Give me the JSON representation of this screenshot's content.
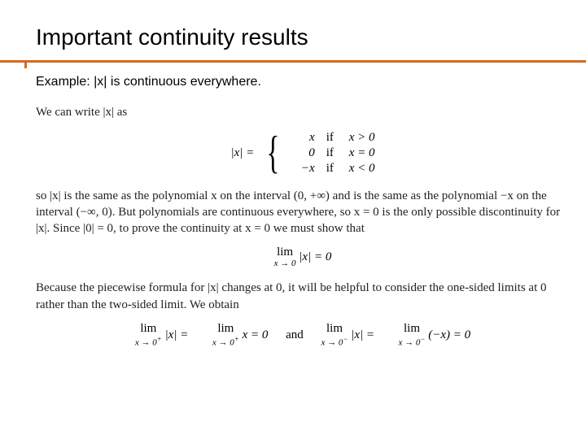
{
  "title": "Important continuity results",
  "example_label": "Example: |x| is continuous everywhere.",
  "intro": "We can write |x| as",
  "piecewise": {
    "lhs": "|x| =",
    "cases": [
      {
        "val": "x",
        "if": "if",
        "cond": "x > 0"
      },
      {
        "val": "0",
        "if": "if",
        "cond": "x = 0"
      },
      {
        "val": "−x",
        "if": "if",
        "cond": "x < 0"
      }
    ]
  },
  "para1": "so |x| is the same as the polynomial x on the interval (0, +∞) and is the same as the polynomial −x on the interval (−∞, 0). But polynomials are continuous everywhere, so x = 0 is the only possible discontinuity for |x|. Since |0| = 0, to prove the continuity at x = 0 we must show that",
  "limit_center": {
    "lim": "lim",
    "sub": "x → 0",
    "expr": "|x| = 0"
  },
  "para2": "Because the piecewise formula for |x| changes at 0, it will be helpful to consider the one-sided limits at 0 rather than the two-sided limit. We obtain",
  "limits_row": {
    "left": {
      "lim": "lim",
      "sub1": "x → 0",
      "sup1": "+",
      "expr1": "|x| =",
      "sub2": "x → 0",
      "sup2": "+",
      "expr2": "x = 0"
    },
    "and": "and",
    "right": {
      "lim": "lim",
      "sub1": "x → 0",
      "sup1": "−",
      "expr1": "|x| =",
      "sub2": "x → 0",
      "sup2": "−",
      "expr2": "(−x) = 0"
    }
  }
}
